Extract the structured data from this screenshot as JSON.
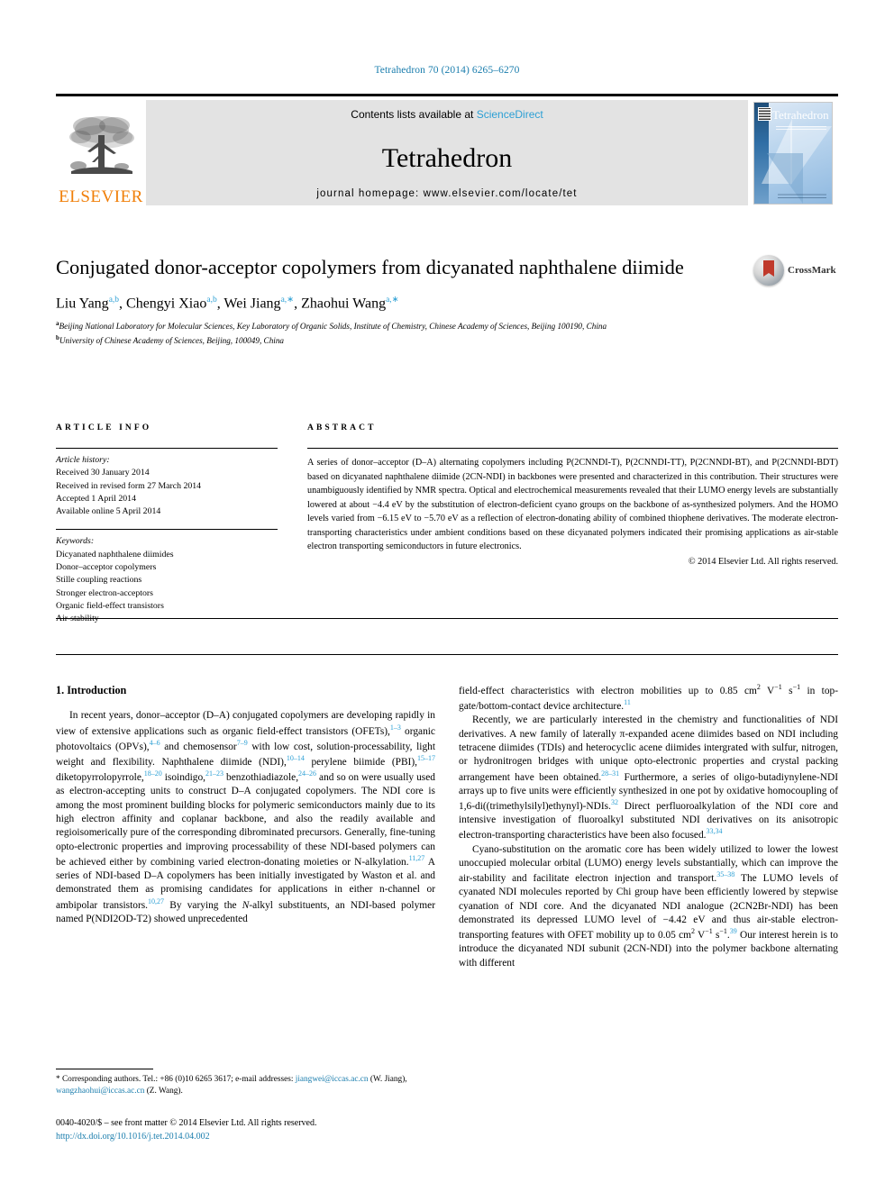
{
  "running_head": "Tetrahedron 70 (2014) 6265–6270",
  "masthead": {
    "contents_prefix": "Contents lists available at ",
    "sciencedirect": "ScienceDirect",
    "journal_name": "Tetrahedron",
    "homepage": "journal homepage: www.elsevier.com/locate/tet",
    "publisher": "ELSEVIER",
    "cover_title": "Tetrahedron",
    "sciencedirect_color": "#2b9fd4",
    "elsevier_color": "#f07f09"
  },
  "article": {
    "title": "Conjugated donor-acceptor copolymers from dicyanated naphthalene diimide",
    "authors_html": "Liu Yang<sup>a,b</sup>, Chengyi Xiao<sup>a,b</sup>, Wei Jiang<sup>a,∗</sup>, Zhaohui Wang<sup>a,∗</sup>",
    "affiliation_a": "Beijing National Laboratory for Molecular Sciences, Key Laboratory of Organic Solids, Institute of Chemistry, Chinese Academy of Sciences, Beijing 100190, China",
    "affiliation_b": "University of Chinese Academy of Sciences, Beijing, 100049, China",
    "crossmark_label": "CrossMark"
  },
  "info": {
    "heading": "ARTICLE INFO",
    "history_label": "Article history:",
    "history": [
      "Received 30 January 2014",
      "Received in revised form 27 March 2014",
      "Accepted 1 April 2014",
      "Available online 5 April 2014"
    ],
    "keywords_label": "Keywords:",
    "keywords": [
      "Dicyanated naphthalene diimides",
      "Donor–acceptor copolymers",
      "Stille coupling reactions",
      "Stronger electron-acceptors",
      "Organic field-effect transistors",
      "Air-stability"
    ]
  },
  "abstract": {
    "heading": "ABSTRACT",
    "text": "A series of donor–acceptor (D–A) alternating copolymers including P(2CNNDI-T), P(2CNNDI-TT), P(2CNNDI-BT), and P(2CNNDI-BDT) based on dicyanated naphthalene diimide (2CN-NDI) in backbones were presented and characterized in this contribution. Their structures were unambiguously identified by NMR spectra. Optical and electrochemical measurements revealed that their LUMO energy levels are substantially lowered at about −4.4 eV by the substitution of electron-deficient cyano groups on the backbone of as-synthesized polymers. And the HOMO levels varied from −6.15 eV to −5.70 eV as a reflection of electron-donating ability of combined thiophene derivatives. The moderate electron-transporting characteristics under ambient conditions based on these dicyanated polymers indicated their promising applications as air-stable electron transporting semiconductors in future electronics.",
    "copyright": "© 2014 Elsevier Ltd. All rights reserved."
  },
  "body": {
    "section_number_title": "1. Introduction",
    "left_paragraph_1_html": "In recent years, donor–acceptor (D–A) conjugated copolymers are developing rapidly in view of extensive applications such as organic field-effect transistors (OFETs),<sup class=\"ref\">1–3</sup> organic photovoltaics (OPVs),<sup class=\"ref\">4–6</sup> and chemosensor<sup class=\"ref\">7–9</sup> with low cost, solution-processability, light weight and flexibility. Naphthalene diimide (NDI),<sup class=\"ref\">10–14</sup> perylene biimide (PBI),<sup class=\"ref\">15–17</sup> diketopyrrolopyrrole,<sup class=\"ref\">18–20</sup> isoindigo,<sup class=\"ref\">21–23</sup> benzothiadiazole,<sup class=\"ref\">24–26</sup> and so on were usually used as electron-accepting units to construct D–A conjugated copolymers. The NDI core is among the most prominent building blocks for polymeric semiconductors mainly due to its high electron affinity and coplanar backbone, and also the readily available and regioisomerically pure of the corresponding dibrominated precursors. Generally, fine-tuning opto-electronic properties and improving processability of these NDI-based polymers can be achieved either by combining varied electron-donating moieties or N-alkylation.<sup class=\"ref\">11,27</sup> A series of NDI-based D–A copolymers has been initially investigated by Waston et al. and demonstrated them as promising candidates for applications in either n-channel or ambipolar transistors.<sup class=\"ref\">10,27</sup> By varying the <i>N</i>-alkyl substituents, an NDI-based polymer named P(NDI2OD-T2) showed unprecedented",
    "right_paragraph_1_html": "field-effect characteristics with electron mobilities up to 0.85 cm<sup class=\"plain\">2</sup> V<sup class=\"plain\">−1</sup> s<sup class=\"plain\">−1</sup> in top-gate/bottom-contact device architecture.<sup class=\"ref\">11</sup>",
    "right_paragraph_2_html": "Recently, we are particularly interested in the chemistry and functionalities of NDI derivatives. A new family of laterally π-expanded acene diimides based on NDI including tetracene diimides (TDIs) and heterocyclic acene diimides intergrated with sulfur, nitrogen, or hydronitrogen bridges with unique opto-electronic properties and crystal packing arrangement have been obtained.<sup class=\"ref\">28–31</sup> Furthermore, a series of oligo-butadiynylene-NDI arrays up to five units were efficiently synthesized in one pot by oxidative homocoupling of 1,6-di((trimethylsilyl)ethynyl)-NDIs.<sup class=\"ref\">32</sup> Direct perfluoroalkylation of the NDI core and intensive investigation of fluoroalkyl substituted NDI derivatives on its anisotropic electron-transporting characteristics have been also focused.<sup class=\"ref\">33,34</sup>",
    "right_paragraph_3_html": "Cyano-substitution on the aromatic core has been widely utilized to lower the lowest unoccupied molecular orbital (LUMO) energy levels substantially, which can improve the air-stability and facilitate electron injection and transport.<sup class=\"ref\">35–38</sup> The LUMO levels of cyanated NDI molecules reported by Chi group have been efficiently lowered by stepwise cyanation of NDI core. And the dicyanated NDI analogue (2CN2Br-NDI) has been demonstrated its depressed LUMO level of −4.42 eV and thus air-stable electron-transporting features with OFET mobility up to 0.05 cm<sup class=\"plain\">2</sup> V<sup class=\"plain\">−1</sup> s<sup class=\"plain\">−1</sup>.<sup class=\"ref\">39</sup> Our interest herein is to introduce the dicyanated NDI subunit (2CN-NDI) into the polymer backbone alternating with different"
  },
  "footer": {
    "corresponding_html": "* Corresponding authors. Tel.: +86 (0)10 6265 3617; e-mail addresses: <span class=\"link\">jiangwei@iccas.ac.cn</span> (W. Jiang), <span class=\"link\">wangzhaohui@iccas.ac.cn</span> (Z. Wang).",
    "front_matter": "0040-4020/$ – see front matter © 2014 Elsevier Ltd. All rights reserved.",
    "doi": "http://dx.doi.org/10.1016/j.tet.2014.04.002",
    "link_color": "#1a7dad"
  }
}
